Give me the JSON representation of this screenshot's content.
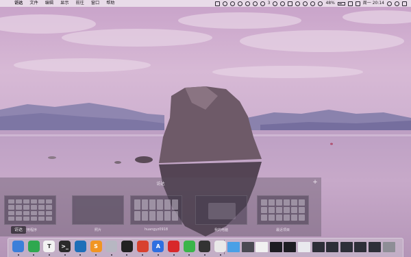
{
  "menubar": {
    "apple": "",
    "items": [
      "访达",
      "文件",
      "编辑",
      "显示",
      "前往",
      "窗口",
      "帮助"
    ],
    "status": {
      "notif_count": "3",
      "battery": "48%",
      "clock": "周一 20:14"
    }
  },
  "mission_control": {
    "space_label": "访达",
    "add_space": "+",
    "thumbnails": [
      {
        "label": "应用程序"
      },
      {
        "label": "照片"
      },
      {
        "label": "huangyz0918"
      },
      {
        "label": "我的电脑"
      },
      {
        "label": "最近项目"
      }
    ]
  },
  "tooltip": "访达",
  "dock": {
    "apps": [
      {
        "name": "finder-icon",
        "color": "#3b7fd9",
        "glyph": ""
      },
      {
        "name": "evernote-icon",
        "color": "#2fa84f",
        "glyph": ""
      },
      {
        "name": "typora-icon",
        "color": "#f2f2f2",
        "glyph": "T"
      },
      {
        "name": "terminal-icon",
        "color": "#2a2a2a",
        "glyph": ">_"
      },
      {
        "name": "vscode-icon",
        "color": "#1e6fb8",
        "glyph": ""
      },
      {
        "name": "sublime-icon",
        "color": "#f19522",
        "glyph": "S"
      },
      {
        "name": "preview-icon",
        "color": "#b7b7c2",
        "glyph": ""
      },
      {
        "name": "qq-icon",
        "color": "#222222",
        "glyph": ""
      },
      {
        "name": "pdf-icon",
        "color": "#d8412f",
        "glyph": ""
      },
      {
        "name": "navigation-icon",
        "color": "#2f6fe0",
        "glyph": "A"
      },
      {
        "name": "netease-music-icon",
        "color": "#d8282a",
        "glyph": ""
      },
      {
        "name": "wechat-icon",
        "color": "#3ab54a",
        "glyph": ""
      },
      {
        "name": "console-icon",
        "color": "#333333",
        "glyph": ""
      },
      {
        "name": "chrome-icon",
        "color": "#e8e8e8",
        "glyph": ""
      }
    ],
    "right": [
      {
        "name": "folder-icon",
        "color": "#4aa0e6"
      },
      {
        "name": "window-thumb-icon",
        "color": "#4a4a52"
      },
      {
        "name": "document-icon",
        "color": "#f1f1f1"
      },
      {
        "name": "terminal-window-icon",
        "color": "#1d1d22"
      },
      {
        "name": "terminal-window-icon",
        "color": "#1d1d22"
      },
      {
        "name": "image-window-icon",
        "color": "#e9e9ee"
      },
      {
        "name": "window-thumb-icon",
        "color": "#2d2f38"
      },
      {
        "name": "window-thumb-icon",
        "color": "#2d2f38"
      },
      {
        "name": "window-thumb-icon",
        "color": "#2d2f38"
      },
      {
        "name": "window-thumb-icon",
        "color": "#2d2f38"
      },
      {
        "name": "window-thumb-icon",
        "color": "#2d2f38"
      },
      {
        "name": "trash-icon",
        "color": "#8e8e96"
      }
    ]
  }
}
